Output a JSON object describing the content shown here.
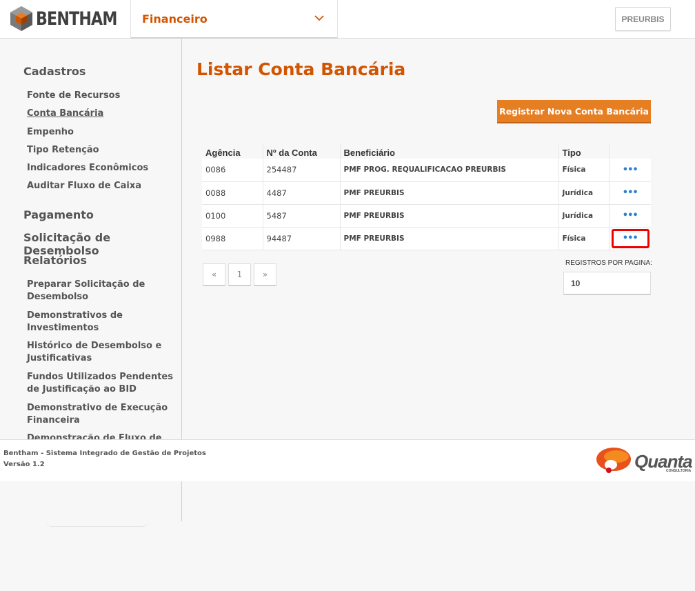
{
  "header": {
    "logo_text": "BENTHAM",
    "module": "Financeiro",
    "user_button": "PREURBIS"
  },
  "sidebar": {
    "sections": {
      "cadastros": "Cadastros",
      "pagamento": "Pagamento",
      "solicitacao": "Solicitação de Desembolso",
      "relatorios": "Relatórios"
    },
    "cadastros_items": [
      "Fonte de Recursos",
      "Conta Bancária",
      "Empenho",
      "Tipo Retenção",
      "Indicadores Econômicos",
      "Auditar Fluxo de Caixa"
    ],
    "relatorios_items": [
      "Preparar Solicitação de Desembolso",
      "Demonstrativos de Investimentos",
      "Histórico de Desembolso e Justificativas",
      "Fundos Utilizados Pendentes de Justificação ao BID",
      "Demonstrativo de Execução Financeira",
      "Demonstração de Fluxo de Caixa"
    ]
  },
  "main": {
    "title": "Listar Conta Bancária",
    "new_button": "Registrar Nova Conta Bancária",
    "columns": [
      "Agência",
      "Nº da Conta",
      "Beneficiário",
      "Tipo",
      ""
    ],
    "rows": [
      {
        "agencia": "0086",
        "conta": "254487",
        "beneficiario": "PMF PROG. REQUALIFICACAO PREURBIS",
        "tipo": "Física",
        "actions": "•••"
      },
      {
        "agencia": "0088",
        "conta": "4487",
        "beneficiario": "PMF PREURBIS",
        "tipo": "Jurídica",
        "actions": "•••"
      },
      {
        "agencia": "0100",
        "conta": "5487",
        "beneficiario": "PMF PREURBIS",
        "tipo": "Jurídica",
        "actions": "•••"
      },
      {
        "agencia": "0988",
        "conta": "94487",
        "beneficiario": "PMF PREURBIS",
        "tipo": "Física",
        "actions": "•••"
      }
    ],
    "pager": {
      "prev": "«",
      "page": "1",
      "next": "»"
    },
    "per_page_label": "REGISTROS POR PAGINA:",
    "per_page_value": "10"
  },
  "footer": {
    "line1": "Bentham - Sistema Integrado de Gestão de Projetos",
    "line2": "Versão 1.2",
    "brand": "Quanta",
    "brand_sub": "CONSULTORIA"
  },
  "colors": {
    "accent": "#d35400",
    "button": "#e67e22",
    "link_dots": "#2a7fd4",
    "highlight": "#ee0000"
  }
}
